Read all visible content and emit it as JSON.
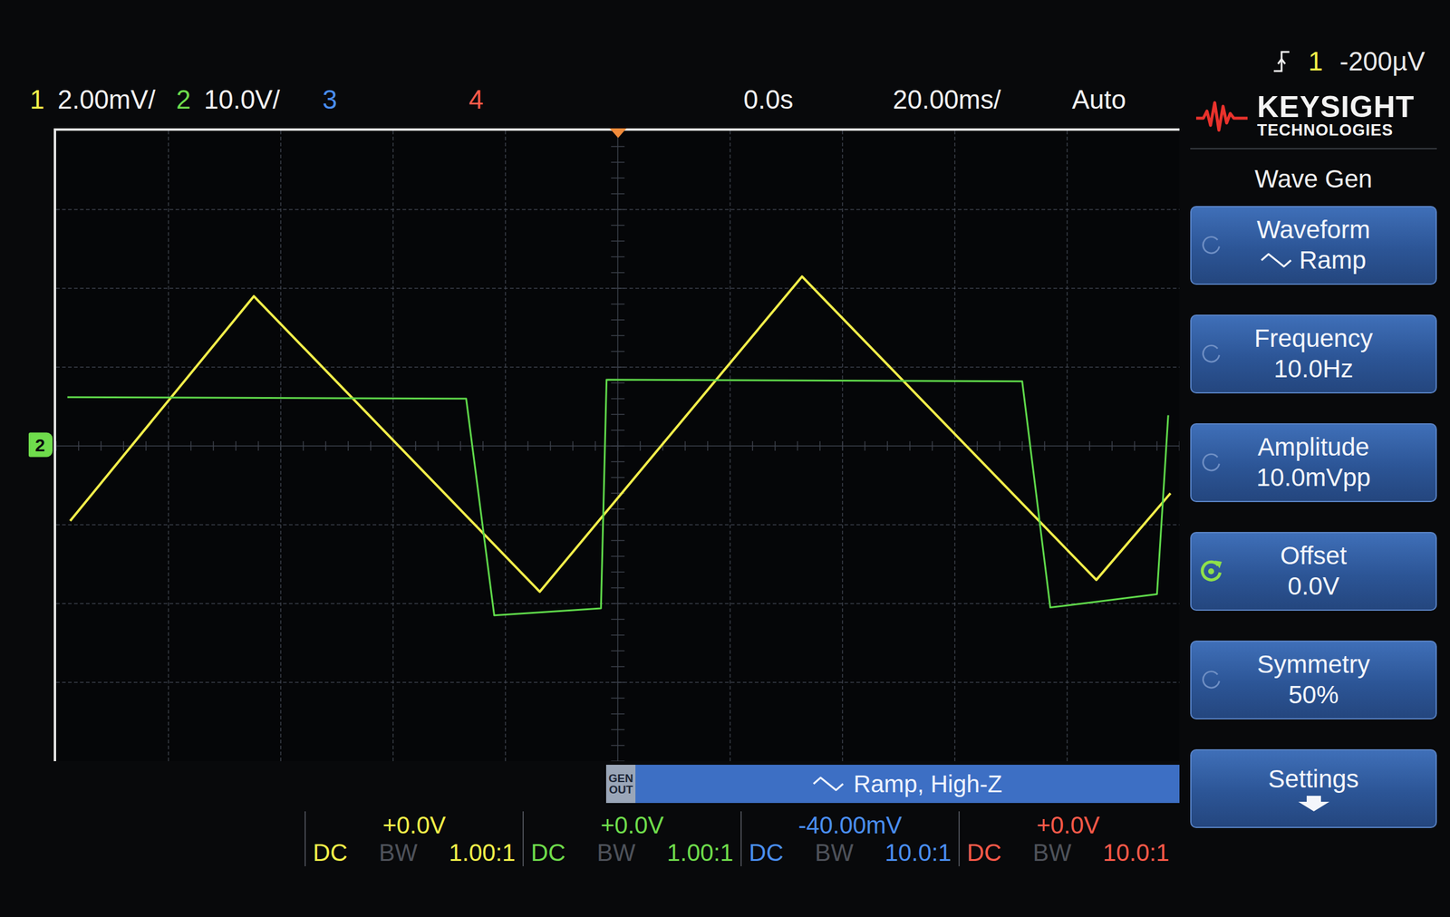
{
  "status_bar": {
    "channels": [
      {
        "number": "1",
        "scale": "2.00mV/",
        "color": "#f4f14a"
      },
      {
        "number": "2",
        "scale": "10.0V/",
        "color": "#6fdc4c"
      },
      {
        "number": "3",
        "scale": "",
        "color": "#4a8ef0"
      },
      {
        "number": "4",
        "scale": "",
        "color": "#ff5a4a"
      }
    ],
    "time_offset": "0.0s",
    "time_scale": "20.00ms/",
    "trigger_mode": "Auto",
    "trigger_source": "1",
    "trigger_level": "-200µV"
  },
  "logo": {
    "name": "KEYSIGHT",
    "subtitle": "TECHNOLOGIES"
  },
  "menu": {
    "title": "Wave Gen",
    "softkeys": [
      {
        "label": "Waveform",
        "value": "Ramp",
        "kind": "ramp"
      },
      {
        "label": "Frequency",
        "value": "10.0Hz",
        "kind": "plain"
      },
      {
        "label": "Amplitude",
        "value": "10.0mVpp",
        "kind": "plain"
      },
      {
        "label": "Offset",
        "value": "0.0V",
        "kind": "knob"
      },
      {
        "label": "Symmetry",
        "value": "50%",
        "kind": "plain"
      },
      {
        "label": "Settings",
        "value": "",
        "kind": "more"
      }
    ]
  },
  "gen_out": {
    "label": "GEN OUT",
    "status": "Ramp, High-Z"
  },
  "channel_info": [
    {
      "coupling": "DC",
      "bw": "BW",
      "offset": "+0.0V",
      "probe": "1.00:1",
      "color": "#f4f14a"
    },
    {
      "coupling": "DC",
      "bw": "BW",
      "offset": "+0.0V",
      "probe": "1.00:1",
      "color": "#6fdc4c"
    },
    {
      "coupling": "DC",
      "bw": "BW",
      "offset": "-40.00mV",
      "probe": "10.0:1",
      "color": "#4a8ef0"
    },
    {
      "coupling": "DC",
      "bw": "BW",
      "offset": "+0.0V",
      "probe": "10.0:1",
      "color": "#ff5a4a"
    }
  ],
  "chart": {
    "ground_marker": "2",
    "series": [
      {
        "channel": "1",
        "color": "#f2ee4a",
        "unit": "mV",
        "per_div": 2,
        "times_ms": [
          -97.5,
          -64.8,
          -13.9,
          32.8,
          85.2,
          98.4
        ],
        "values": [
          -1.9,
          3.8,
          -3.7,
          4.3,
          -3.4,
          -1.2
        ]
      },
      {
        "channel": "2",
        "color": "#5fd84a",
        "unit": "V",
        "per_div": 10,
        "times_ms": [
          -98,
          -27,
          -22,
          -3,
          -2,
          72,
          77,
          96,
          98
        ],
        "values": [
          6.2,
          6.0,
          -21.5,
          -20.6,
          8.4,
          8.2,
          -20.5,
          -18.8,
          3.9
        ]
      }
    ]
  }
}
